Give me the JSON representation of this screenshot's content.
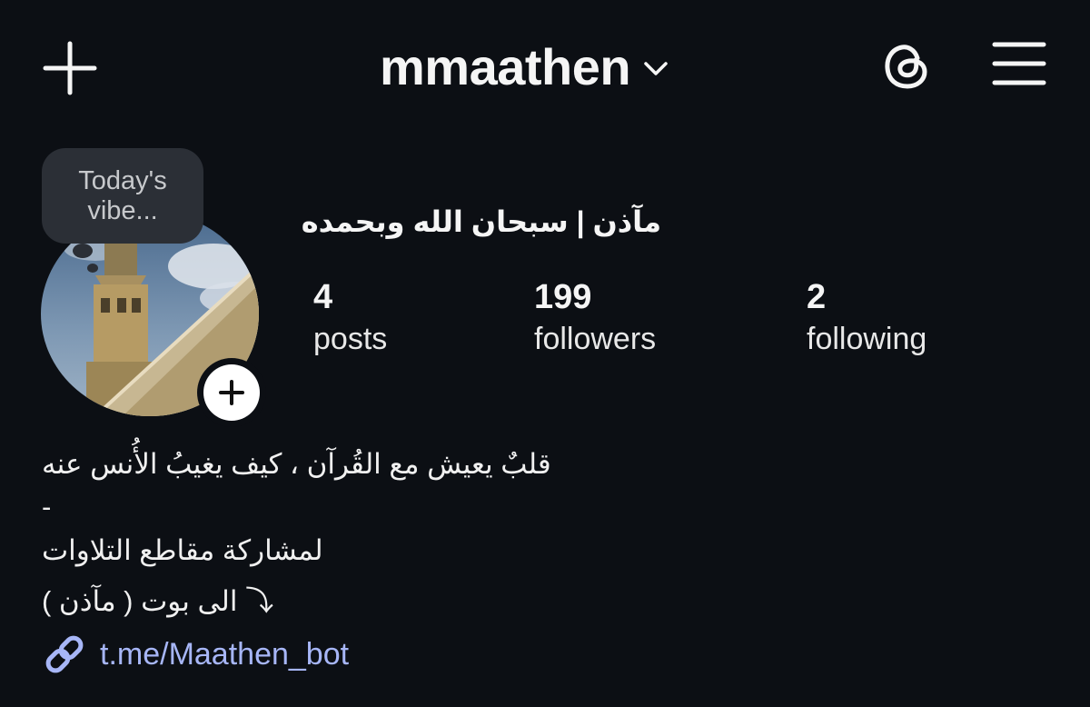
{
  "header": {
    "username": "mmaathen",
    "icons": {
      "new_post": "plus-icon",
      "switch_account": "chevron-down-icon",
      "threads": "threads-icon",
      "menu": "hamburger-menu-icon"
    }
  },
  "profile": {
    "note": "Today's vibe...",
    "display_name": "مآذن | سبحان الله وبحمده",
    "stats": [
      {
        "value": "4",
        "label": "posts"
      },
      {
        "value": "199",
        "label": "followers"
      },
      {
        "value": "2",
        "label": "following"
      }
    ],
    "bio": [
      "قلبٌ يعيش مع القُرآن ، كيف يغيبُ الأُنس عنه",
      "-",
      "لمشاركة مقاطع التلاوات",
      "الى بوت ( مآذن ) ⤵"
    ],
    "link": {
      "icon": "link-icon",
      "text": "t.me/Maathen_bot"
    }
  },
  "colors": {
    "background": "#0c0f14",
    "link": "#a7b6f7",
    "note_bg": "#2b2f36"
  }
}
